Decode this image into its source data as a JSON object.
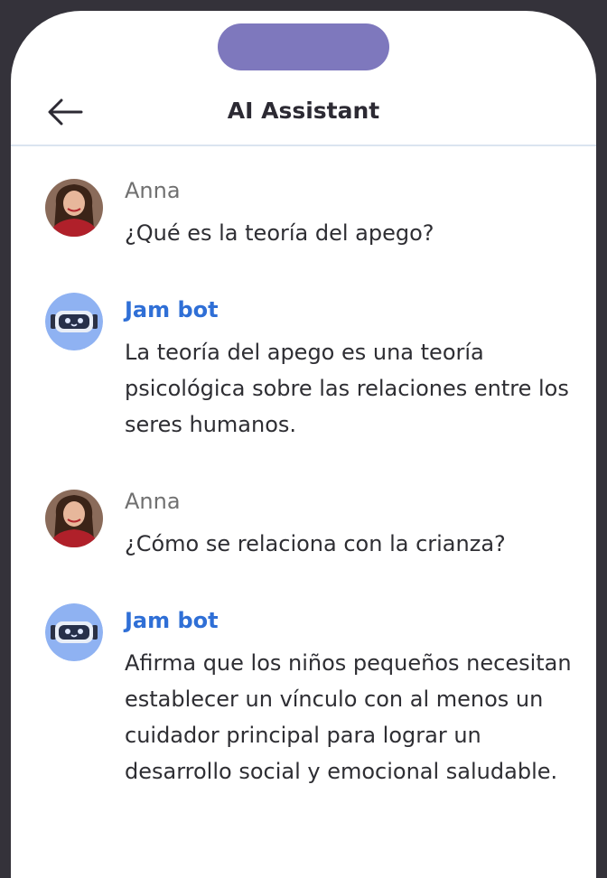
{
  "header": {
    "title": "AI Assistant"
  },
  "messages": [
    {
      "sender": "Anna",
      "role": "user",
      "text": "¿Qué es la teoría del apego?"
    },
    {
      "sender": "Jam bot",
      "role": "bot",
      "text": "La teoría del apego es una teoría psicológica sobre las relaciones entre los seres humanos."
    },
    {
      "sender": "Anna",
      "role": "user",
      "text": "¿Cómo se relaciona con la crianza?"
    },
    {
      "sender": "Jam bot",
      "role": "bot",
      "text": "Afirma que los niños pequeños necesitan establecer un vínculo con al menos un cuidador principal para lograr un desarrollo social y emocional saludable."
    }
  ],
  "colors": {
    "notch": "#7e78bd",
    "bot_name": "#2f6fd6",
    "bot_avatar": "#8fb2f2",
    "frame": "#34323a"
  },
  "icons": {
    "back": "arrow-left-icon",
    "bot": "robot-icon"
  }
}
